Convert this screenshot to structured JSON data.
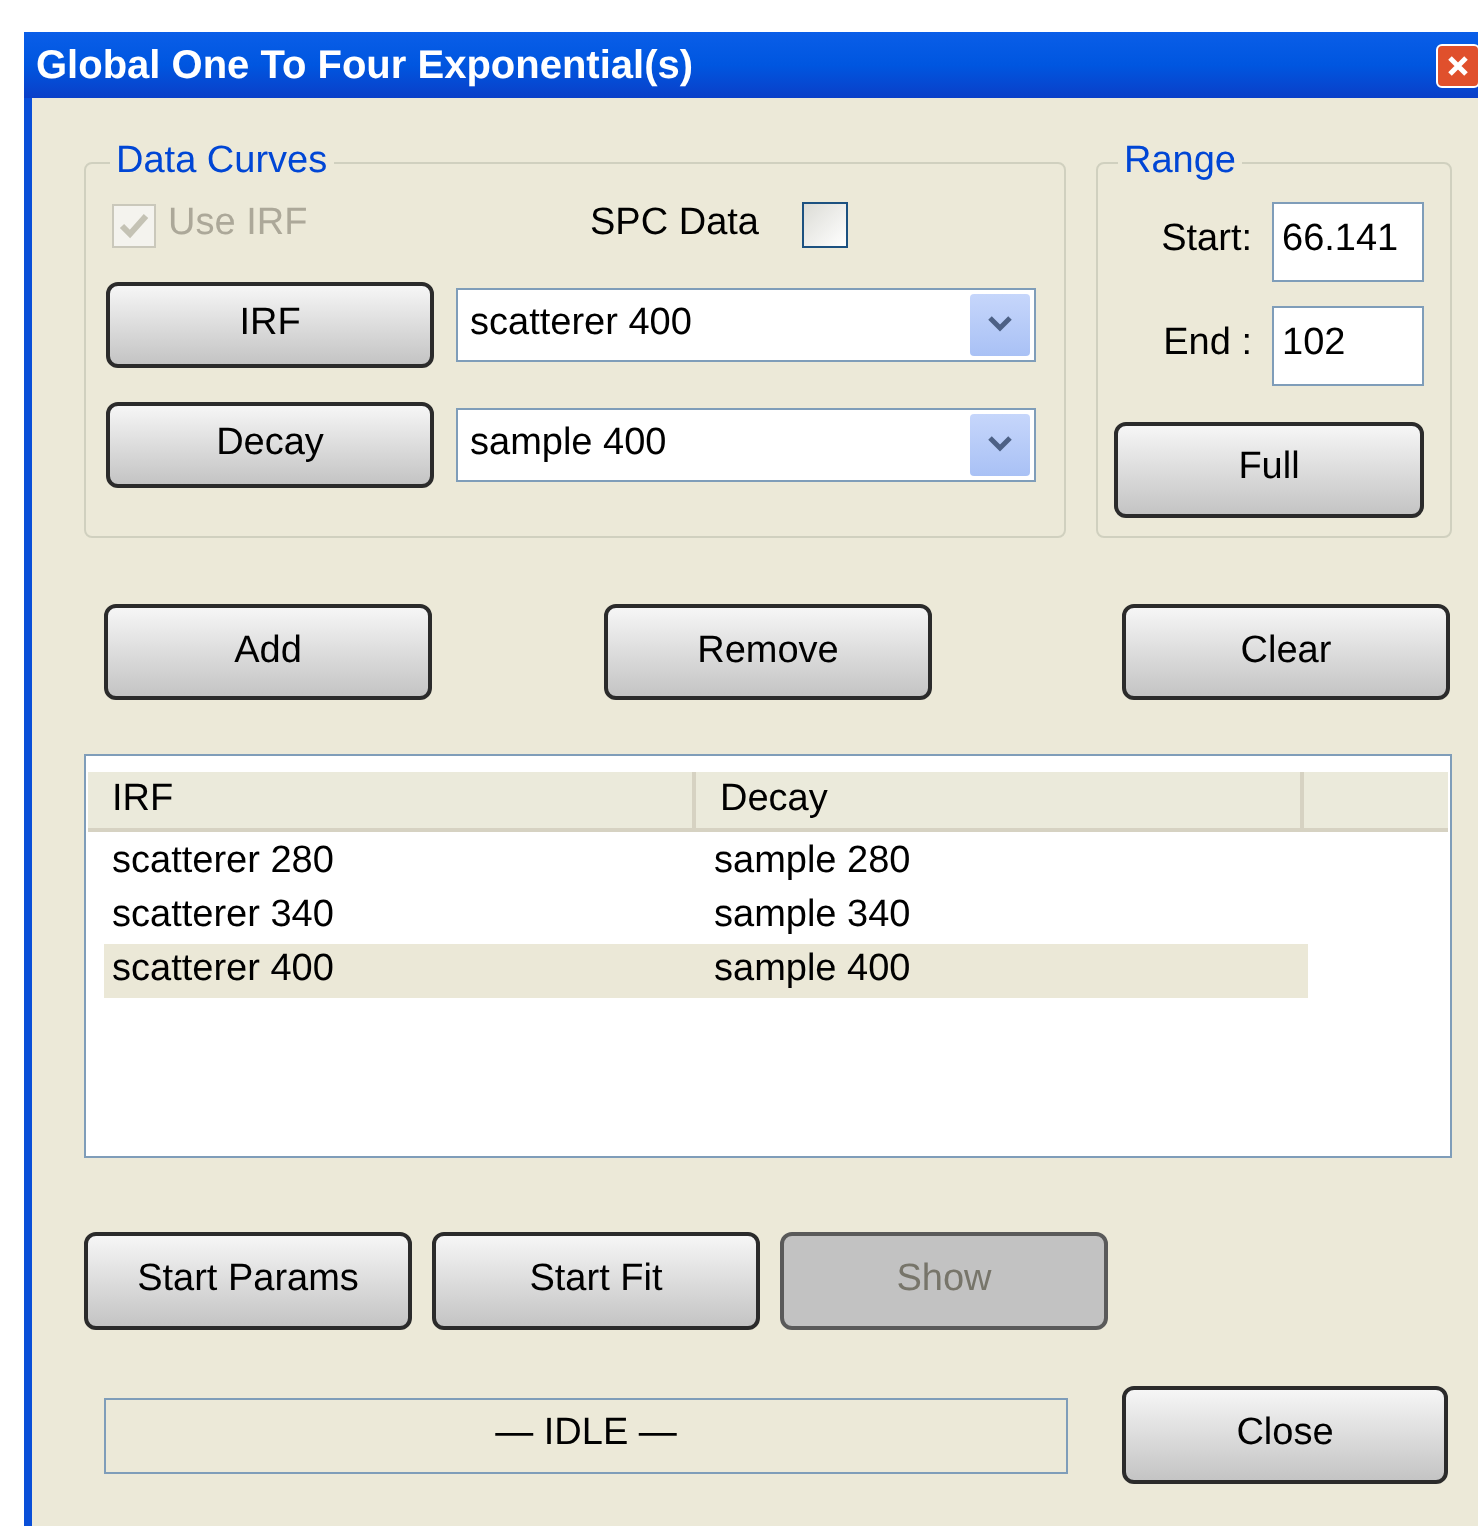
{
  "window": {
    "title": "Global One To Four Exponential(s)"
  },
  "data_curves": {
    "title": "Data Curves",
    "use_irf": {
      "label": "Use IRF",
      "checked": true,
      "disabled": true
    },
    "spc_data": {
      "label": "SPC Data",
      "checked": false
    },
    "irf": {
      "button": "IRF",
      "value": "scatterer 400"
    },
    "decay": {
      "button": "Decay",
      "value": "sample 400"
    }
  },
  "range": {
    "title": "Range",
    "start": {
      "label": "Start:",
      "value": "66.141"
    },
    "end": {
      "label": "End :",
      "value": "102"
    },
    "button": "Full"
  },
  "actions": [
    {
      "label": "Add"
    },
    {
      "label": "Remove"
    },
    {
      "label": "Clear"
    }
  ],
  "table": {
    "columns": [
      "IRF",
      "Decay"
    ],
    "rows": [
      {
        "cells": [
          "scatterer 280",
          "sample 280"
        ],
        "selected": false
      },
      {
        "cells": [
          "scatterer 340",
          "sample 340"
        ],
        "selected": false
      },
      {
        "cells": [
          "scatterer 400",
          "sample 400"
        ],
        "selected": true
      }
    ]
  },
  "fit_buttons": [
    {
      "label": "Start Params",
      "disabled": false
    },
    {
      "label": "Start Fit",
      "disabled": false
    },
    {
      "label": "Show",
      "disabled": true
    }
  ],
  "status": "— IDLE —",
  "close_button": {
    "label": "Close"
  }
}
